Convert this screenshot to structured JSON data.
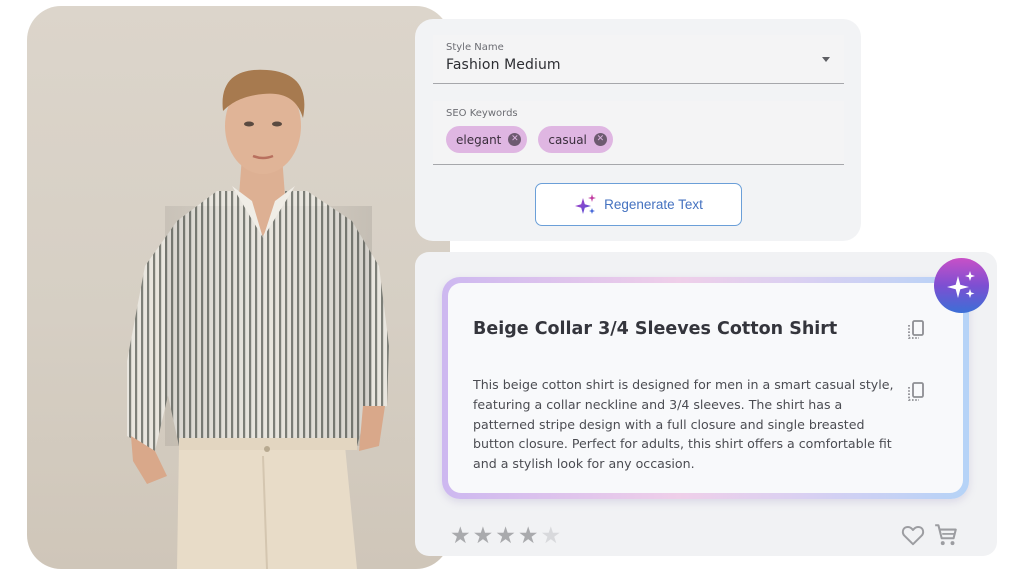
{
  "product_image": {
    "alt": "Male model wearing a beige striped collar shirt with rolled 3/4 sleeves and cream trousers"
  },
  "form": {
    "style_name": {
      "label": "Style Name",
      "value": "Fashion Medium"
    },
    "seo_keywords": {
      "label": "SEO Keywords",
      "chips": [
        {
          "label": "elegant",
          "remove_icon": "cancel-circle-icon"
        },
        {
          "label": "casual",
          "remove_icon": "cancel-circle-icon"
        }
      ]
    },
    "regenerate_button": {
      "label": "Regenerate Text",
      "icon": "sparkles-icon"
    }
  },
  "result": {
    "badge_icon": "ai-sparkles-icon",
    "title": "Beige Collar 3/4 Sleeves Cotton Shirt",
    "description": "This beige cotton shirt is designed for men in a smart casual style, featuring a collar neckline and 3/4 sleeves. The shirt has a patterned stripe design with a full closure and single breasted button closure. Perfect for adults, this shirt offers a comfortable fit and a stylish look for any occasion.",
    "copy_icon": "copy-icon",
    "rating": {
      "value": 4,
      "max": 5
    },
    "actions": [
      "heart-icon",
      "cart-icon"
    ]
  },
  "colors": {
    "chip_bg": "#dfb6e2",
    "button_text": "#4472c0",
    "badge_gradient": [
      "#c850c7",
      "#3b6fd6"
    ],
    "star_filled": "#a9aaad",
    "star_empty": "#d8d9dc"
  }
}
